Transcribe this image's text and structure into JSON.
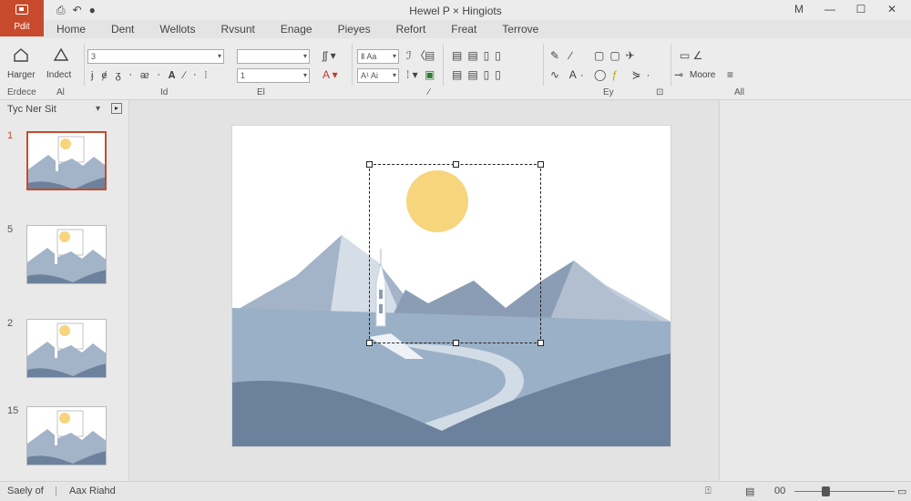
{
  "app": {
    "button_label": "Pdit",
    "window_title": "Hewel P × Hingiots",
    "min_label": "M"
  },
  "qat": {
    "save": "⎙",
    "undo": "↶",
    "redo": "●"
  },
  "tabs": [
    "Home",
    "Dent",
    "Wellots",
    "Rvsunt",
    "Enage",
    "Pieyes",
    "Refort",
    "Freat",
    "Terrove"
  ],
  "ribbon": {
    "btn_harger": "Harger",
    "btn_indect": "Indect",
    "font_box_value": "3",
    "size_box_value": "",
    "size_box2_value": "1",
    "font_style_value": "Ⅱ Aa",
    "font_style2_value": "A¹ Ai",
    "btn_moore": "Moore"
  },
  "groups": {
    "clipboard": "Erdece",
    "a": "Al",
    "font": "Id",
    "para": "El",
    "more": "Ey",
    "end": "All"
  },
  "panel": {
    "title": "Tyc Ner Sit",
    "ctrl": "▾"
  },
  "thumbs": [
    {
      "num": "1",
      "active": true
    },
    {
      "num": "5",
      "active": false
    },
    {
      "num": "2",
      "active": false
    },
    {
      "num": "15",
      "active": false
    }
  ],
  "status": {
    "left": "Saely of",
    "mid": "Aax Riahd",
    "zoom": "00"
  },
  "colors": {
    "accent": "#c84a2c",
    "sun": "#f6d57d",
    "mountain_light": "#a3b3c8",
    "mountain_mid": "#8b9db4",
    "mountain_dark": "#6c819c",
    "ground": "#9ab0c6"
  }
}
